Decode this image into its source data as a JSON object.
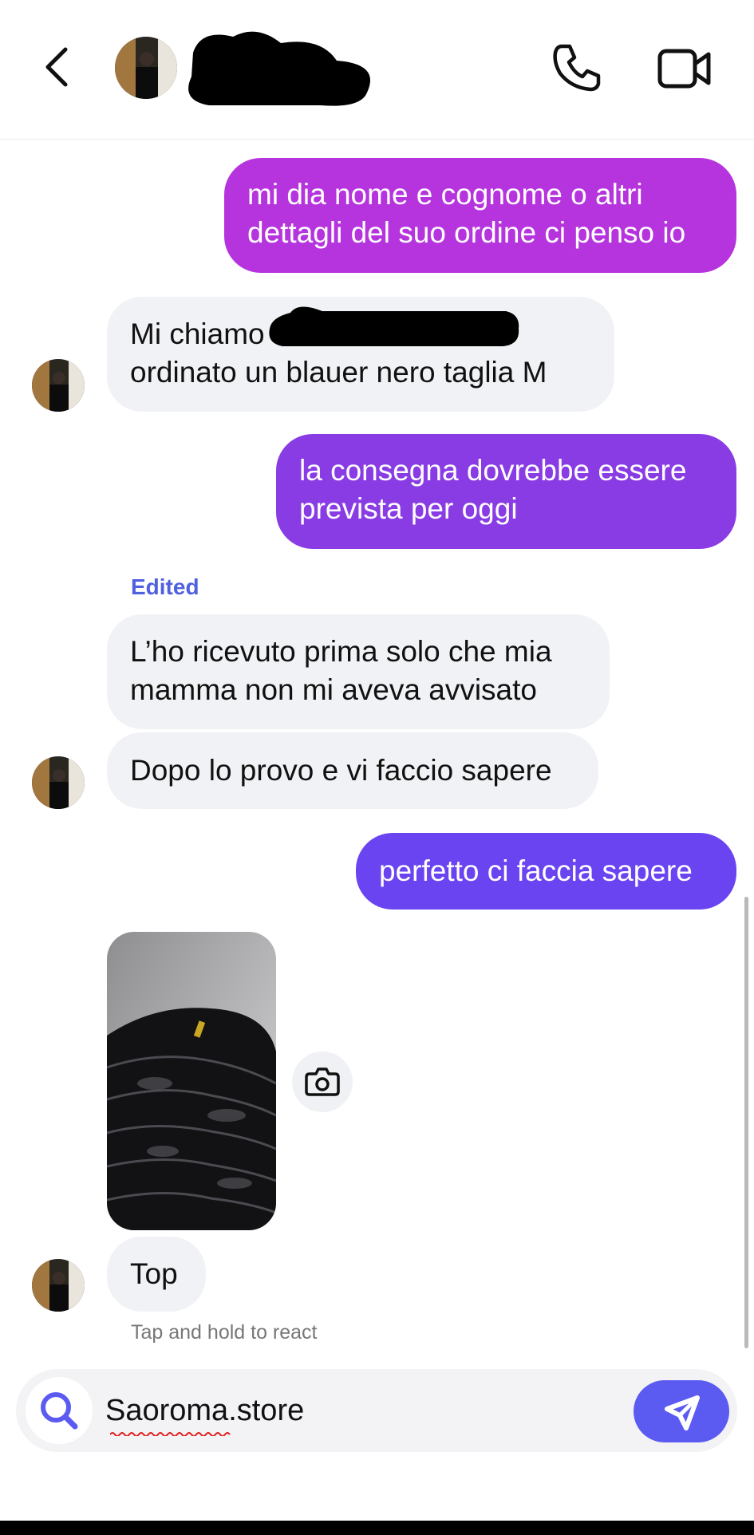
{
  "colors": {
    "bubble_1": "#b634dd",
    "bubble_2": "#8a3ce4",
    "bubble_3": "#6a44f0",
    "incoming_bg": "#f1f2f5",
    "accent": "#5b5bf1",
    "edited_label": "#5060e0"
  },
  "header": {
    "back_icon": "chevron-left-icon",
    "call_icon": "phone-icon",
    "video_icon": "video-camera-icon"
  },
  "messages": [
    {
      "from": "me",
      "text": "mi dia nome e cognome o altri\ndettagli del suo ordine ci penso io"
    },
    {
      "from": "them",
      "text": "Mi chiamo                            e ho\nordinato un blauer nero taglia M"
    },
    {
      "from": "me",
      "text": "la consegna dovrebbe essere\nprevista per oggi"
    },
    {
      "from": "them",
      "edited_label": "Edited",
      "text": "L’ho ricevuto prima solo che mia\nmamma non mi aveva avvisato"
    },
    {
      "from": "them",
      "text": "Dopo lo provo e vi faccio sapere"
    },
    {
      "from": "me",
      "text": "perfetto ci faccia sapere"
    },
    {
      "from": "them",
      "type": "photo",
      "icon": "camera-icon"
    },
    {
      "from": "them",
      "text": "Top"
    }
  ],
  "reaction_hint": "Tap and hold to react",
  "composer": {
    "value": "Saoroma.store",
    "search_icon": "search-icon",
    "send_icon": "send-icon"
  }
}
